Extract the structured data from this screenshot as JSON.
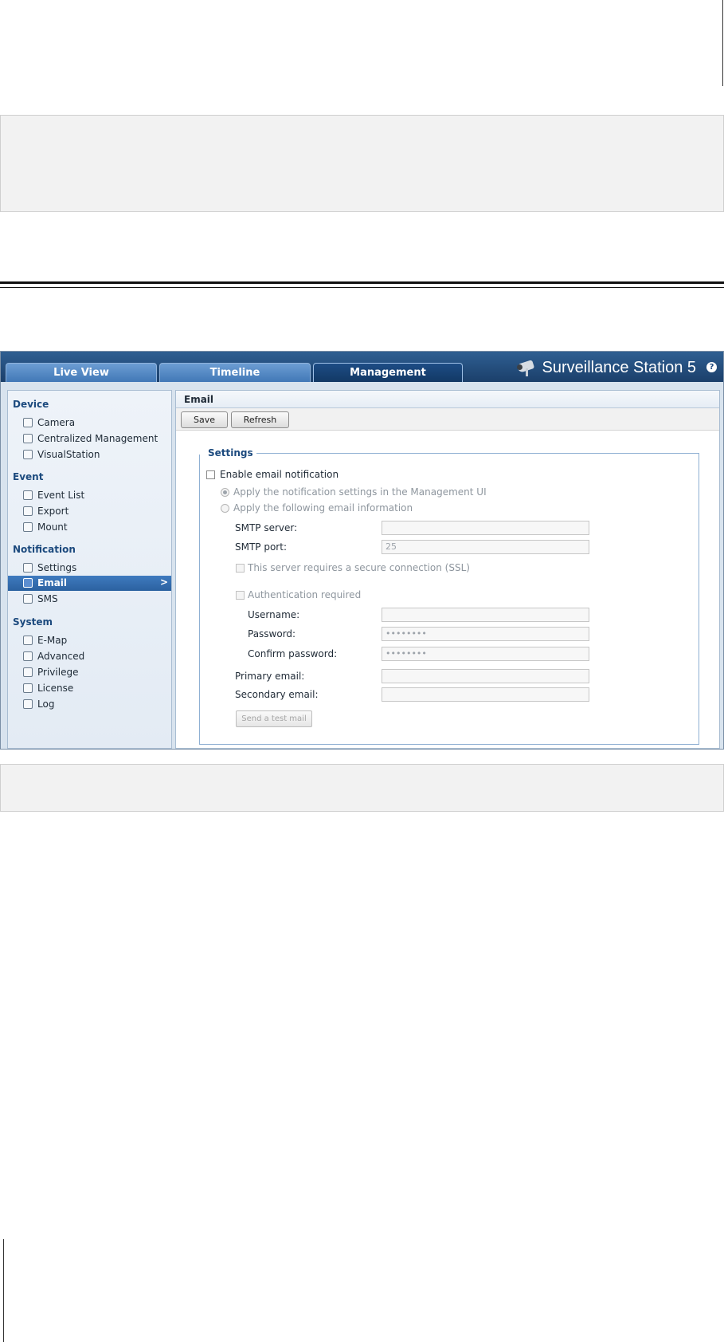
{
  "app": {
    "brand": "Surveillance Station 5",
    "help_glyph": "?",
    "tabs": [
      {
        "label": "Live View",
        "active": false
      },
      {
        "label": "Timeline",
        "active": false
      },
      {
        "label": "Management",
        "active": true
      }
    ]
  },
  "sidebar": {
    "groups": [
      {
        "label": "Device",
        "items": [
          {
            "label": "Camera",
            "icon": "camera-icon"
          },
          {
            "label": "Centralized Management",
            "icon": "centralized-management-icon"
          },
          {
            "label": "VisualStation",
            "icon": "visualstation-icon"
          }
        ]
      },
      {
        "label": "Event",
        "items": [
          {
            "label": "Event List",
            "icon": "event-list-icon"
          },
          {
            "label": "Export",
            "icon": "export-icon"
          },
          {
            "label": "Mount",
            "icon": "mount-icon"
          }
        ]
      },
      {
        "label": "Notification",
        "items": [
          {
            "label": "Settings",
            "icon": "wrench-icon"
          },
          {
            "label": "Email",
            "icon": "envelope-icon",
            "active": true
          },
          {
            "label": "SMS",
            "icon": "sms-icon"
          }
        ]
      },
      {
        "label": "System",
        "items": [
          {
            "label": "E-Map",
            "icon": "emap-icon"
          },
          {
            "label": "Advanced",
            "icon": "gear-icon"
          },
          {
            "label": "Privilege",
            "icon": "users-icon"
          },
          {
            "label": "License",
            "icon": "key-icon"
          },
          {
            "label": "Log",
            "icon": "book-icon"
          }
        ]
      }
    ],
    "active_chevron": ">"
  },
  "content": {
    "title": "Email",
    "toolbar": {
      "save_label": "Save",
      "refresh_label": "Refresh"
    },
    "settings": {
      "legend": "Settings",
      "enable_label": "Enable email notification",
      "radio_management_ui": "Apply the notification settings in the Management UI",
      "radio_following": "Apply the following email information",
      "smtp_server_label": "SMTP server:",
      "smtp_server_value": "",
      "smtp_port_label": "SMTP port:",
      "smtp_port_value": "25",
      "ssl_label": "This server requires a secure connection (SSL)",
      "auth_label": "Authentication required",
      "username_label": "Username:",
      "username_value": "",
      "password_label": "Password:",
      "password_value": "••••••••",
      "confirm_password_label": "Confirm password:",
      "confirm_password_value": "••••••••",
      "primary_email_label": "Primary email:",
      "primary_email_value": "",
      "secondary_email_label": "Secondary email:",
      "secondary_email_value": "",
      "send_test_label": "Send a test mail"
    }
  }
}
